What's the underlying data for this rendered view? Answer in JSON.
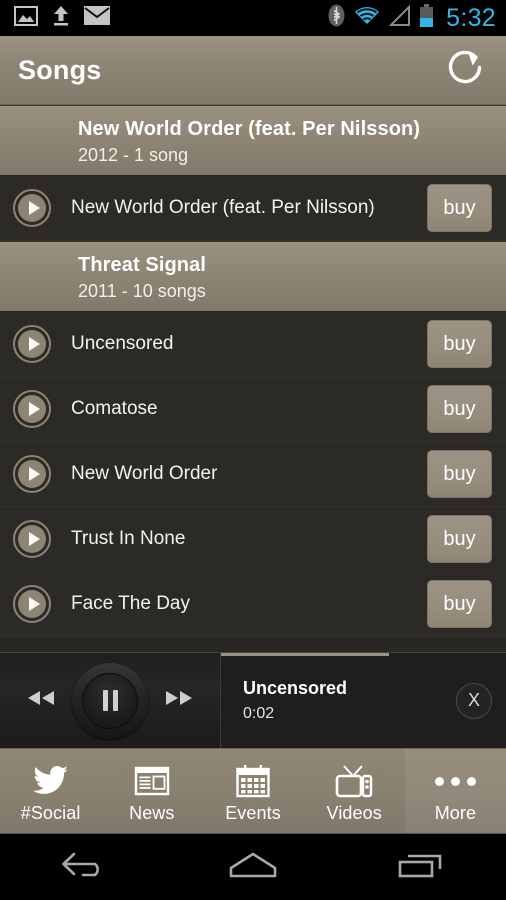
{
  "statusbar": {
    "time": "5:32",
    "icons_left": [
      "image-icon",
      "upload-icon",
      "mail-icon"
    ],
    "icons_right": [
      "bluetooth-icon",
      "wifi-icon",
      "signal-icon",
      "battery-icon"
    ],
    "accent_color": "#33b5e5"
  },
  "actionbar": {
    "title": "Songs",
    "refresh_icon": "refresh-icon"
  },
  "list": {
    "sections": [
      {
        "album": "New World Order (feat. Per Nilsson)",
        "meta": "2012 - 1 song",
        "songs": [
          {
            "title": "New World Order (feat. Per Nilsson)",
            "action": "buy"
          }
        ]
      },
      {
        "album": "Threat Signal",
        "meta": "2011 - 10 songs",
        "songs": [
          {
            "title": "Uncensored",
            "action": "buy"
          },
          {
            "title": "Comatose",
            "action": "buy"
          },
          {
            "title": "New World Order",
            "action": "buy"
          },
          {
            "title": "Trust In None",
            "action": "buy"
          },
          {
            "title": "Face The Day",
            "action": "buy"
          }
        ]
      }
    ]
  },
  "player": {
    "prev_icon": "rewind-icon",
    "playpause_icon": "pause-icon",
    "next_icon": "fast-forward-icon",
    "track_title": "Uncensored",
    "elapsed": "0:02",
    "close_label": "X"
  },
  "tabbar": {
    "tabs": [
      {
        "label": "#Social",
        "icon": "twitter-bird-icon",
        "selected": false
      },
      {
        "label": "News",
        "icon": "newspaper-icon",
        "selected": false
      },
      {
        "label": "Events",
        "icon": "calendar-icon",
        "selected": false
      },
      {
        "label": "Videos",
        "icon": "television-icon",
        "selected": false
      },
      {
        "label": "More",
        "icon": "ellipsis-icon",
        "selected": true
      }
    ]
  },
  "navbar": {
    "buttons": [
      {
        "name": "back",
        "icon": "back-arrow-icon"
      },
      {
        "name": "home",
        "icon": "home-icon"
      },
      {
        "name": "recents",
        "icon": "recents-icon"
      }
    ]
  },
  "theme": {
    "tan": "#8d8474",
    "dark": "#2b2a26",
    "accent_blue": "#33b5e5"
  }
}
